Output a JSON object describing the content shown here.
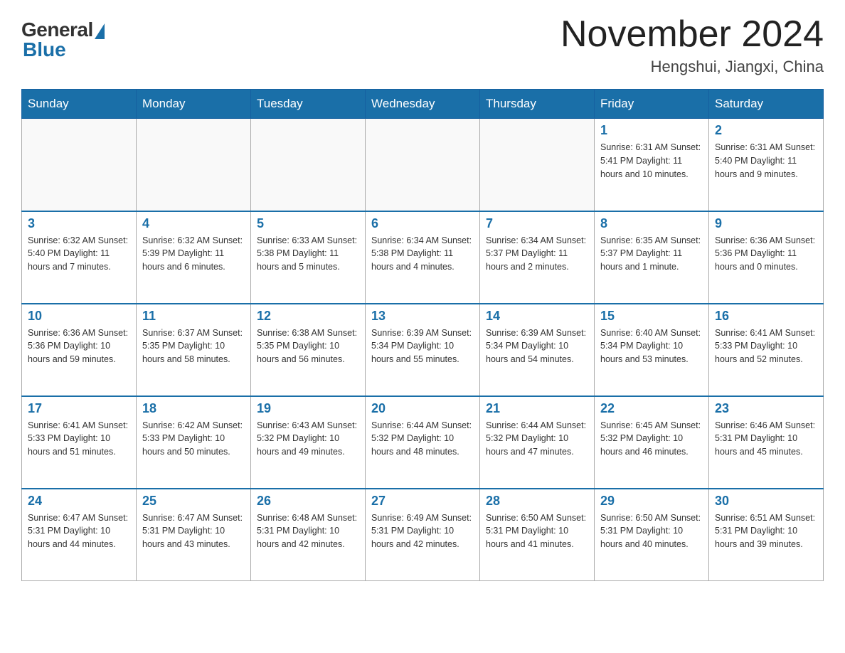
{
  "header": {
    "logo_general": "General",
    "logo_blue": "Blue",
    "title": "November 2024",
    "location": "Hengshui, Jiangxi, China"
  },
  "weekdays": [
    "Sunday",
    "Monday",
    "Tuesday",
    "Wednesday",
    "Thursday",
    "Friday",
    "Saturday"
  ],
  "weeks": [
    [
      {
        "day": "",
        "info": ""
      },
      {
        "day": "",
        "info": ""
      },
      {
        "day": "",
        "info": ""
      },
      {
        "day": "",
        "info": ""
      },
      {
        "day": "",
        "info": ""
      },
      {
        "day": "1",
        "info": "Sunrise: 6:31 AM\nSunset: 5:41 PM\nDaylight: 11 hours and 10 minutes."
      },
      {
        "day": "2",
        "info": "Sunrise: 6:31 AM\nSunset: 5:40 PM\nDaylight: 11 hours and 9 minutes."
      }
    ],
    [
      {
        "day": "3",
        "info": "Sunrise: 6:32 AM\nSunset: 5:40 PM\nDaylight: 11 hours and 7 minutes."
      },
      {
        "day": "4",
        "info": "Sunrise: 6:32 AM\nSunset: 5:39 PM\nDaylight: 11 hours and 6 minutes."
      },
      {
        "day": "5",
        "info": "Sunrise: 6:33 AM\nSunset: 5:38 PM\nDaylight: 11 hours and 5 minutes."
      },
      {
        "day": "6",
        "info": "Sunrise: 6:34 AM\nSunset: 5:38 PM\nDaylight: 11 hours and 4 minutes."
      },
      {
        "day": "7",
        "info": "Sunrise: 6:34 AM\nSunset: 5:37 PM\nDaylight: 11 hours and 2 minutes."
      },
      {
        "day": "8",
        "info": "Sunrise: 6:35 AM\nSunset: 5:37 PM\nDaylight: 11 hours and 1 minute."
      },
      {
        "day": "9",
        "info": "Sunrise: 6:36 AM\nSunset: 5:36 PM\nDaylight: 11 hours and 0 minutes."
      }
    ],
    [
      {
        "day": "10",
        "info": "Sunrise: 6:36 AM\nSunset: 5:36 PM\nDaylight: 10 hours and 59 minutes."
      },
      {
        "day": "11",
        "info": "Sunrise: 6:37 AM\nSunset: 5:35 PM\nDaylight: 10 hours and 58 minutes."
      },
      {
        "day": "12",
        "info": "Sunrise: 6:38 AM\nSunset: 5:35 PM\nDaylight: 10 hours and 56 minutes."
      },
      {
        "day": "13",
        "info": "Sunrise: 6:39 AM\nSunset: 5:34 PM\nDaylight: 10 hours and 55 minutes."
      },
      {
        "day": "14",
        "info": "Sunrise: 6:39 AM\nSunset: 5:34 PM\nDaylight: 10 hours and 54 minutes."
      },
      {
        "day": "15",
        "info": "Sunrise: 6:40 AM\nSunset: 5:34 PM\nDaylight: 10 hours and 53 minutes."
      },
      {
        "day": "16",
        "info": "Sunrise: 6:41 AM\nSunset: 5:33 PM\nDaylight: 10 hours and 52 minutes."
      }
    ],
    [
      {
        "day": "17",
        "info": "Sunrise: 6:41 AM\nSunset: 5:33 PM\nDaylight: 10 hours and 51 minutes."
      },
      {
        "day": "18",
        "info": "Sunrise: 6:42 AM\nSunset: 5:33 PM\nDaylight: 10 hours and 50 minutes."
      },
      {
        "day": "19",
        "info": "Sunrise: 6:43 AM\nSunset: 5:32 PM\nDaylight: 10 hours and 49 minutes."
      },
      {
        "day": "20",
        "info": "Sunrise: 6:44 AM\nSunset: 5:32 PM\nDaylight: 10 hours and 48 minutes."
      },
      {
        "day": "21",
        "info": "Sunrise: 6:44 AM\nSunset: 5:32 PM\nDaylight: 10 hours and 47 minutes."
      },
      {
        "day": "22",
        "info": "Sunrise: 6:45 AM\nSunset: 5:32 PM\nDaylight: 10 hours and 46 minutes."
      },
      {
        "day": "23",
        "info": "Sunrise: 6:46 AM\nSunset: 5:31 PM\nDaylight: 10 hours and 45 minutes."
      }
    ],
    [
      {
        "day": "24",
        "info": "Sunrise: 6:47 AM\nSunset: 5:31 PM\nDaylight: 10 hours and 44 minutes."
      },
      {
        "day": "25",
        "info": "Sunrise: 6:47 AM\nSunset: 5:31 PM\nDaylight: 10 hours and 43 minutes."
      },
      {
        "day": "26",
        "info": "Sunrise: 6:48 AM\nSunset: 5:31 PM\nDaylight: 10 hours and 42 minutes."
      },
      {
        "day": "27",
        "info": "Sunrise: 6:49 AM\nSunset: 5:31 PM\nDaylight: 10 hours and 42 minutes."
      },
      {
        "day": "28",
        "info": "Sunrise: 6:50 AM\nSunset: 5:31 PM\nDaylight: 10 hours and 41 minutes."
      },
      {
        "day": "29",
        "info": "Sunrise: 6:50 AM\nSunset: 5:31 PM\nDaylight: 10 hours and 40 minutes."
      },
      {
        "day": "30",
        "info": "Sunrise: 6:51 AM\nSunset: 5:31 PM\nDaylight: 10 hours and 39 minutes."
      }
    ]
  ]
}
